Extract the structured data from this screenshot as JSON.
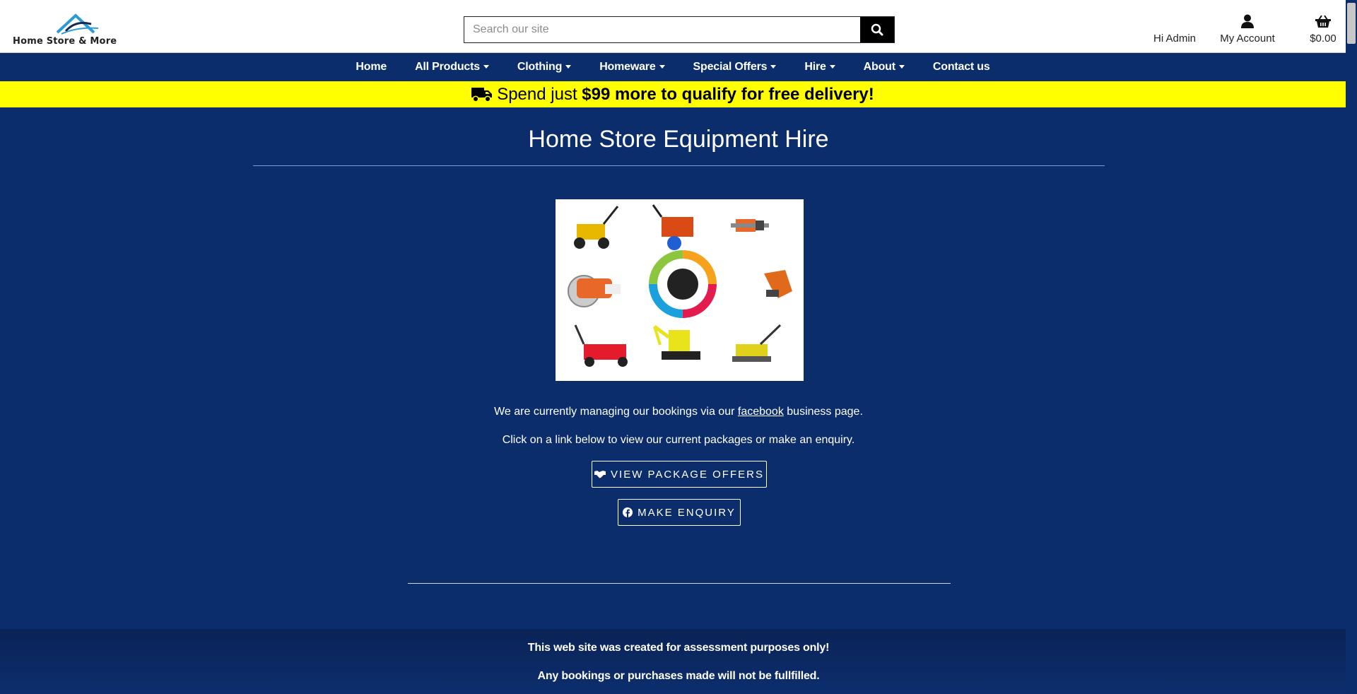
{
  "header": {
    "logo_text": "Home Store & More",
    "search_placeholder": "Search our site",
    "greeting": "Hi Admin",
    "account_label": "My Account",
    "cart_total": "$0.00"
  },
  "nav": {
    "items": [
      {
        "label": "Home",
        "dropdown": false
      },
      {
        "label": "All Products",
        "dropdown": true
      },
      {
        "label": "Clothing",
        "dropdown": true
      },
      {
        "label": "Homeware",
        "dropdown": true
      },
      {
        "label": "Special Offers",
        "dropdown": true
      },
      {
        "label": "Hire",
        "dropdown": true
      },
      {
        "label": "About",
        "dropdown": true
      },
      {
        "label": "Contact us",
        "dropdown": false
      }
    ]
  },
  "promo": {
    "text_start": "Spend just",
    "amount_text": "$99 more to qualify for free delivery!"
  },
  "main": {
    "title": "Home Store Equipment Hire",
    "paragraph1_before": "We are currently managing our bookings via our",
    "paragraph1_link": "facebook",
    "paragraph1_after": "business page.",
    "paragraph2": "Click on a link below to view our current packages or make an enquiry.",
    "button_packages": "VIEW PACKAGE OFFERS",
    "button_enquiry": "MAKE ENQUIRY"
  },
  "footer": {
    "line1": "This web site was created for assessment purposes only!",
    "line2": "Any bookings or purchases made will not be fullfilled."
  },
  "colors": {
    "brand_navy": "#0b2d6b",
    "promo_yellow": "#ffff00",
    "logo_blue": "#2b9bd8"
  },
  "icons": {
    "search": "search-icon",
    "account": "user-icon",
    "cart": "basket-icon",
    "truck": "truck-icon",
    "packages": "handshake-icon",
    "enquiry": "facebook-icon"
  }
}
